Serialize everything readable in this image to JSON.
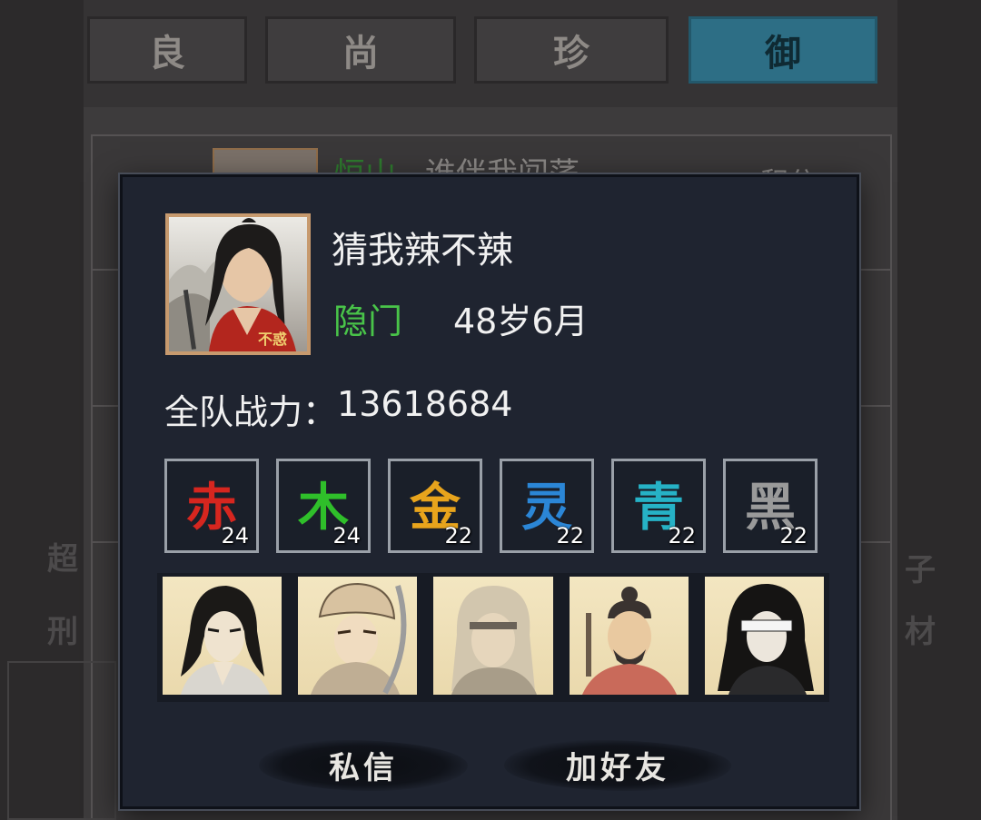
{
  "background": {
    "tabs": [
      {
        "label": "良",
        "active": false
      },
      {
        "label": "尚",
        "active": false
      },
      {
        "label": "珍",
        "active": false
      },
      {
        "label": "御",
        "active": true
      }
    ],
    "first_row": {
      "faction": "恒山",
      "name": "谁伴我闯荡",
      "score_label": "积分"
    },
    "side_left": [
      "超",
      "刑"
    ],
    "side_right": [
      "子",
      "材"
    ]
  },
  "profile": {
    "avatar_icon": "player-portrait",
    "name": "猜我辣不辣",
    "faction": "隐门",
    "age": "48岁6月",
    "power_label": "全队战力：",
    "power_value": "13618684",
    "elements": [
      {
        "glyph": "赤",
        "level": "24",
        "color": "#d6261f"
      },
      {
        "glyph": "木",
        "level": "24",
        "color": "#2fbf2a"
      },
      {
        "glyph": "金",
        "level": "22",
        "color": "#e8a41c"
      },
      {
        "glyph": "灵",
        "level": "22",
        "color": "#2b86d6"
      },
      {
        "glyph": "青",
        "level": "22",
        "color": "#26b2c6"
      },
      {
        "glyph": "黑",
        "level": "22",
        "color": "#9a9a9a"
      }
    ],
    "team": [
      {
        "icon": "swordsman-portrait"
      },
      {
        "icon": "fur-hat-warrior-portrait"
      },
      {
        "icon": "elder-headband-portrait"
      },
      {
        "icon": "bearded-warrior-portrait"
      },
      {
        "icon": "blindfolded-swordsman-portrait"
      }
    ],
    "buttons": {
      "message": "私信",
      "add_friend": "加好友"
    }
  }
}
